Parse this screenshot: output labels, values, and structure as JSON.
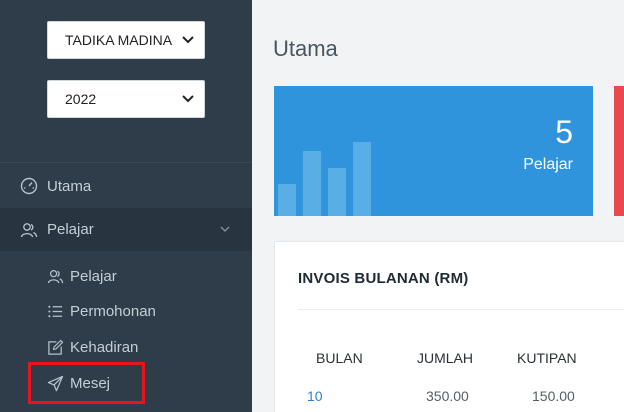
{
  "sidebar": {
    "school_select": {
      "value": "TADIKA MADINAH"
    },
    "year_select": {
      "value": "2022"
    },
    "nav": {
      "utama": {
        "label": "Utama",
        "icon": "dashboard-icon"
      },
      "pelajar": {
        "label": "Pelajar",
        "icon": "users-icon",
        "expanded": true
      }
    },
    "sub": {
      "pelajar": {
        "label": "Pelajar",
        "icon": "users-icon"
      },
      "permohonan": {
        "label": "Permohonan",
        "icon": "list-icon"
      },
      "kehadiran": {
        "label": "Kehadiran",
        "icon": "edit-icon"
      },
      "mesej": {
        "label": "Mesej",
        "icon": "send-icon"
      }
    }
  },
  "main": {
    "title": "Utama",
    "stat_tile": {
      "value": "5",
      "label": "Pelajar",
      "color": "#2f94dc"
    },
    "accent_red": "#e9484e",
    "invoice": {
      "title": "INVOIS BULANAN (RM)",
      "columns": [
        "BULAN",
        "JUMLAH",
        "KUTIPAN"
      ],
      "rows": [
        {
          "bulan": "10",
          "jumlah": "350.00",
          "kutipan": "150.00"
        }
      ]
    }
  },
  "colors": {
    "sidebar_bg": "#2f3d4a",
    "highlight": "#e8141b",
    "link": "#2f7fcf"
  }
}
